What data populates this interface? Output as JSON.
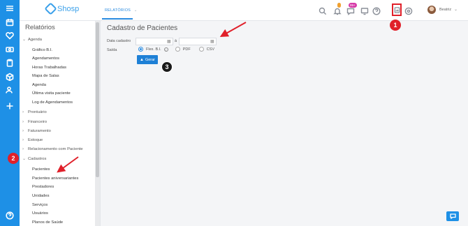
{
  "app": {
    "brand": "Shosp"
  },
  "topbar": {
    "tab_label": "RELATÓRIOS",
    "notification_badge": "99+",
    "user_name": "Beatriz"
  },
  "sidebar": {
    "title": "Relatórios",
    "groups": [
      {
        "label": "Agenda",
        "expanded": true,
        "items": [
          "Gráfico B.I.",
          "Agendamentos",
          "Horas Trabalhadas",
          "Mapa de Salas",
          "Agenda",
          "Última visita paciente",
          "Log de Agendamentos"
        ]
      },
      {
        "label": "Prontuário",
        "expanded": false
      },
      {
        "label": "Financeiro",
        "expanded": false
      },
      {
        "label": "Faturamento",
        "expanded": false
      },
      {
        "label": "Estoque",
        "expanded": false
      },
      {
        "label": "Relacionamento com Paciente",
        "expanded": false
      },
      {
        "label": "Cadastros",
        "expanded": true,
        "items": [
          "Pacientes",
          "Pacientes aniversariantes",
          "Prestadores",
          "Unidades",
          "Serviços",
          "Usuários",
          "Planos de Saúde"
        ]
      }
    ]
  },
  "main": {
    "page_title": "Cadastro de Pacientes",
    "date_label": "Data cadastro",
    "date_separator": "à",
    "output_label": "Saída",
    "output_options": [
      "Flex. B.I.",
      "PDF",
      "CSV"
    ],
    "output_selected": "Flex. B.I.",
    "generate_label": "Gerar"
  },
  "annotations": {
    "marker_1": "1",
    "marker_2": "2",
    "marker_3": "3"
  },
  "colors": {
    "brand": "#1e90e6",
    "accent": "#2a8be0",
    "annotation_red": "#e0202a"
  }
}
